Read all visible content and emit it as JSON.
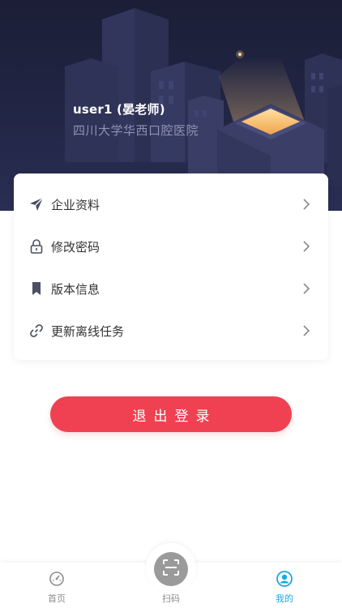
{
  "profile": {
    "name": "user1 (晏老师)",
    "organization": "四川大学华西口腔医院"
  },
  "menu": {
    "items": [
      {
        "label": "企业资料",
        "icon": "send-icon"
      },
      {
        "label": "修改密码",
        "icon": "lock-icon"
      },
      {
        "label": "版本信息",
        "icon": "bookmark-icon"
      },
      {
        "label": "更新离线任务",
        "icon": "link-icon"
      }
    ]
  },
  "logout": {
    "label": "退出登录"
  },
  "tabbar": {
    "items": [
      {
        "label": "首页",
        "icon": "dashboard-icon",
        "active": false
      },
      {
        "label": "扫码",
        "icon": "scan-icon",
        "active": false
      },
      {
        "label": "我的",
        "icon": "user-icon",
        "active": true
      }
    ]
  },
  "colors": {
    "hero_bg": "#1b1e36",
    "accent": "#1aa8e8",
    "logout": "#ef4152"
  }
}
